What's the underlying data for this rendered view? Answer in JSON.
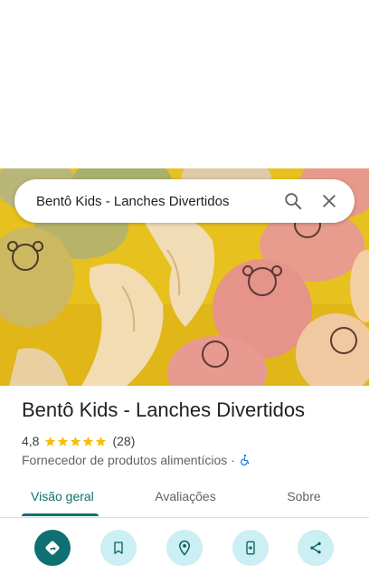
{
  "search": {
    "value": "Bentô Kids - Lanches Divertidos"
  },
  "place": {
    "name": "Bentô Kids - Lanches Divertidos",
    "rating": "4,8",
    "stars": 5,
    "review_count": "(28)",
    "category": "Fornecedor de produtos alimentícios",
    "separator": "·"
  },
  "tabs": [
    {
      "label": "Visão geral"
    },
    {
      "label": "Avaliações"
    },
    {
      "label": "Sobre"
    }
  ],
  "actions": [
    {
      "icon": "directions-icon"
    },
    {
      "icon": "bookmark-icon"
    },
    {
      "icon": "nearby-icon"
    },
    {
      "icon": "send-to-phone-icon"
    },
    {
      "icon": "share-icon"
    }
  ],
  "colors": {
    "accent": "#0e7072",
    "action_bg": "#cbeff2",
    "star": "#fbbc04",
    "accessibility": "#1a73e8"
  }
}
